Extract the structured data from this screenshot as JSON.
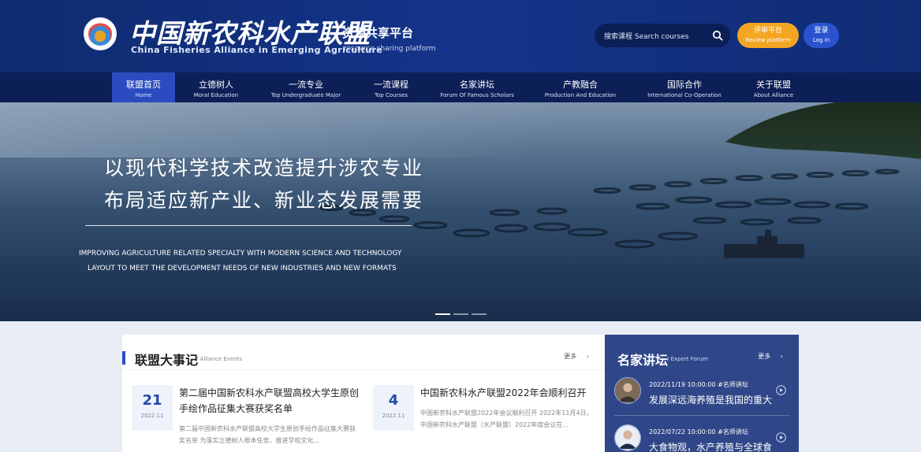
{
  "header": {
    "brand_cn": "中国新农科水产联盟",
    "brand_en": "China Fisheries Alliance in Emerging Agriculture",
    "sub_cn": "资源共享平台",
    "sub_en": "resource sharing platform",
    "search_label": "搜索课程 Search courses",
    "review_cn": "评审平台",
    "review_en": "Review platform",
    "login_cn": "登录",
    "login_en": "Log in"
  },
  "nav": [
    {
      "cn": "联盟首页",
      "en": "Home",
      "active": true
    },
    {
      "cn": "立德树人",
      "en": "Moral Education"
    },
    {
      "cn": "一流专业",
      "en": "Top Undergraduate Major"
    },
    {
      "cn": "一流课程",
      "en": "Top Courses"
    },
    {
      "cn": "名家讲坛",
      "en": "Forum Of Famous Scholars"
    },
    {
      "cn": "产教融合",
      "en": "Production And Education"
    },
    {
      "cn": "国际合作",
      "en": "International Co-Operation"
    },
    {
      "cn": "关于联盟",
      "en": "About Alliance"
    }
  ],
  "hero": {
    "line1": "以现代科学技术改造提升涉农专业",
    "line2": "布局适应新产业、新业态发展需要",
    "en1": "IMPROVING AGRICULTURE RELATED SPECIALTY WITH MODERN SCIENCE AND TECHNOLOGY",
    "en2": "LAYOUT TO MEET THE DEVELOPMENT NEEDS OF NEW INDUSTRIES AND NEW FORMATS"
  },
  "events": {
    "title": "联盟大事记",
    "title_en": "/ Alliance Events",
    "more": "更多",
    "items": [
      {
        "day": "21",
        "ym": "2022.11",
        "title": "第二届中国新农科水产联盟高校大学生原创手绘作品征集大赛获奖名单",
        "desc": "第二届中国新农科水产联盟高校大学生原创手绘作品征集大赛获奖名单 为落实立德树人根本任务，推进学校文化..."
      },
      {
        "day": "4",
        "ym": "2022.11",
        "title": "中国新农科水产联盟2022年会顺利召开",
        "desc": "中国新农科水产联盟2022年会议顺利召开 2022年11月4日，中国新农科水产联盟（水产联盟）2022年度会议在..."
      }
    ]
  },
  "forum": {
    "title": "名家讲坛",
    "title_en": "/ Expert Forum",
    "more": "更多",
    "items": [
      {
        "meta": "2022/11/19 10:00:00   #名师讲坛",
        "text": "发展深远海养殖是我国的重大..."
      },
      {
        "meta": "2022/07/22 10:00:00   #名师讲坛",
        "text": "大食物观，水产养殖与全球食..."
      }
    ]
  },
  "colors": {
    "header_bg": "#14348a",
    "nav_bg": "#0c1f57",
    "accent": "#2b4cc0",
    "review_btn": "#f4a623",
    "forum_bg": "#2f4788"
  }
}
